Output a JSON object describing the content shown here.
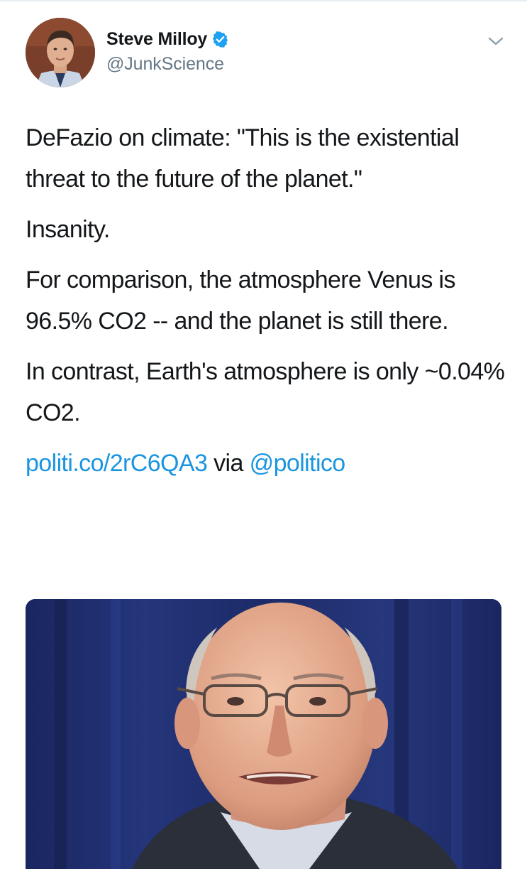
{
  "tweet": {
    "author": {
      "display_name": "Steve Milloy",
      "handle": "@JunkScience",
      "verified": true,
      "avatar_icon": "profile-photo"
    },
    "menu_icon": "chevron-down-icon",
    "paragraphs": [
      "DeFazio on climate: \"This is the existential threat to the future of the planet.\"",
      "Insanity.",
      "For comparison, the atmosphere Venus is 96.5% CO2 -- and the planet is still there.",
      "In contrast, Earth's atmosphere is only ~0.04% CO2."
    ],
    "link": {
      "url_text": "politi.co/2rC6QA3",
      "via_text": "via",
      "mention": "@politico"
    },
    "media": {
      "type": "photo"
    }
  },
  "colors": {
    "text": "#14171a",
    "secondary": "#657786",
    "link": "#1b95e0",
    "verified_badge": "#1da1f2",
    "divider": "#e6ecf0"
  }
}
